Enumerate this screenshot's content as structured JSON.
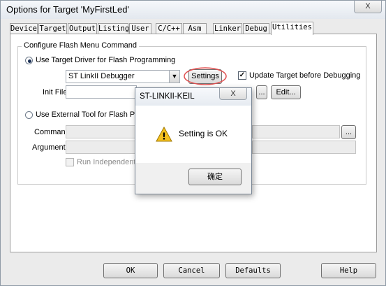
{
  "window": {
    "title": "Options for Target 'MyFirstLed'",
    "close": "X"
  },
  "tabs": [
    {
      "label": "Device"
    },
    {
      "label": "Target"
    },
    {
      "label": "Output"
    },
    {
      "label": "Listing"
    },
    {
      "label": "User"
    },
    {
      "label": "C/C++"
    },
    {
      "label": "Asm"
    },
    {
      "label": "Linker"
    },
    {
      "label": "Debug"
    },
    {
      "label": "Utilities"
    }
  ],
  "active_tab": "Utilities",
  "group": {
    "legend": "Configure Flash Menu Command",
    "use_target_driver_label": "Use Target Driver for Flash Programming",
    "driver_value": "ST LinkII Debugger",
    "settings_label": "Settings",
    "update_target_label": "Update Target before Debugging",
    "init_file_label": "Init File:",
    "browse_label": "...",
    "edit_label": "Edit...",
    "use_external_label": "Use External Tool for Flash Programm",
    "command_label": "Command:",
    "command_browse_label": "...",
    "arguments_label": "Arguments:",
    "run_independent_label": "Run Independent"
  },
  "bottom": {
    "ok": "OK",
    "cancel": "Cancel",
    "defaults": "Defaults",
    "help": "Help"
  },
  "dialog": {
    "title": "ST-LINKII-KEIL",
    "close": "X",
    "message": "Setting is OK",
    "ok_label": "确定",
    "warning_glyph": "!"
  },
  "colors": {
    "highlight_ellipse": "#e05050",
    "warning_fill": "#f4c01e"
  }
}
